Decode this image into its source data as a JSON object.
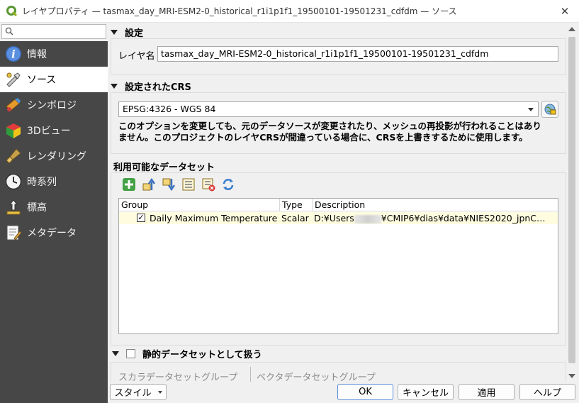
{
  "window": {
    "title": "レイヤプロパティ — tasmax_day_MRI-ESM2-0_historical_r1i1p1f1_19500101-19501231_cdfdm — ソース"
  },
  "search": {
    "placeholder": ""
  },
  "sidebar": {
    "items": [
      {
        "label": "情報",
        "icon": "info-icon"
      },
      {
        "label": "ソース",
        "icon": "source-icon",
        "active": true
      },
      {
        "label": "シンボロジ",
        "icon": "symbology-icon"
      },
      {
        "label": "3Dビュー",
        "icon": "cube-3d-icon"
      },
      {
        "label": "レンダリング",
        "icon": "paintbrush-icon"
      },
      {
        "label": "時系列",
        "icon": "clock-icon"
      },
      {
        "label": "標高",
        "icon": "elevation-icon"
      },
      {
        "label": "メタデータ",
        "icon": "metadata-icon"
      }
    ]
  },
  "settings": {
    "header": "設定",
    "layer_name_label": "レイヤ名",
    "layer_name_value": "tasmax_day_MRI-ESM2-0_historical_r1i1p1f1_19500101-19501231_cdfdm"
  },
  "crs": {
    "header": "設定されたCRS",
    "selected": "EPSG:4326 - WGS 84",
    "note_line1": "このオプションを変更しても、元のデータソースが変更されたり、メッシュの再投影が行われることはあり",
    "note_line2": "ません。このプロジェクトのレイヤCRSが間違っている場合に、CRSを上書きするために使用します。"
  },
  "datasets": {
    "header": "利用可能なデータセット",
    "toolbar": [
      "add-dataset-icon",
      "move-up-icon",
      "move-down-icon",
      "list-icon",
      "remove-list-icon",
      "refresh-icon"
    ],
    "columns": [
      "Group",
      "Type",
      "Description"
    ],
    "rows": [
      {
        "checked": "✓",
        "group": "Daily Maximum Temperature",
        "type": "Scalar",
        "description_prefix": "D:¥Users",
        "description_suffix": "¥CMIP6¥dias¥data¥NIES2020_jpnC…"
      }
    ]
  },
  "static": {
    "header": "静的データセットとして扱う",
    "scalar_group": "スカラデータセットグループ",
    "vector_group": "ベクタデータセットグループ"
  },
  "footer": {
    "style": "スタイル",
    "ok": "OK",
    "cancel": "キャンセル",
    "apply": "適用",
    "help": "ヘルプ"
  },
  "colors": {
    "sidebar_bg": "#474747",
    "selected_row": "#fffde0"
  }
}
